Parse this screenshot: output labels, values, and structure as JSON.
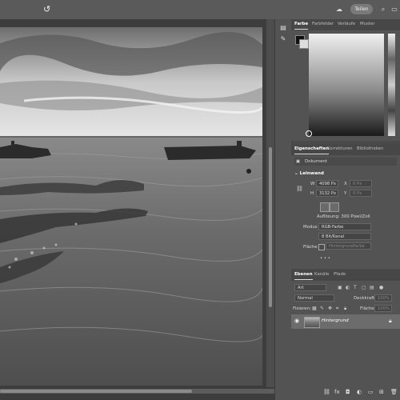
{
  "topbar": {
    "share_label": "Teilen",
    "undo_icon": "rotate-icon"
  },
  "color_panel": {
    "tabs": [
      "Farbe",
      "Farbfelder",
      "Verläufe",
      "Muster"
    ]
  },
  "properties_panel": {
    "tabs": [
      "Eigenschaften",
      "Korrekturen",
      "Bibliotheken"
    ],
    "document_label": "Dokument",
    "canvas_section": "Leinwand",
    "width_label": "W",
    "width_value": "4098 Px",
    "height_label": "H",
    "height_value": "3132 Px",
    "x_label": "X",
    "x_value": "0 Px",
    "y_label": "Y",
    "y_value": "0 Px",
    "resolution": "Auflösung: 300 Pixel/Zoll",
    "mode_label": "Modus",
    "mode_value": "RGB-Farbe",
    "depth_value": "8 Bit/Kanal",
    "fill_label": "Fläche",
    "fill_value": "Hintergrundfarbe",
    "more": "• • •"
  },
  "layers_panel": {
    "tabs": [
      "Ebenen",
      "Kanäle",
      "Pfade"
    ],
    "filter_value": "Art",
    "blend_mode": "Normal",
    "opacity_label": "Deckkraft:",
    "opacity_value": "100%",
    "lock_label": "Fixieren:",
    "fill_label": "Fläche:",
    "fill_value": "100%",
    "layer_name": "Hintergrund"
  }
}
